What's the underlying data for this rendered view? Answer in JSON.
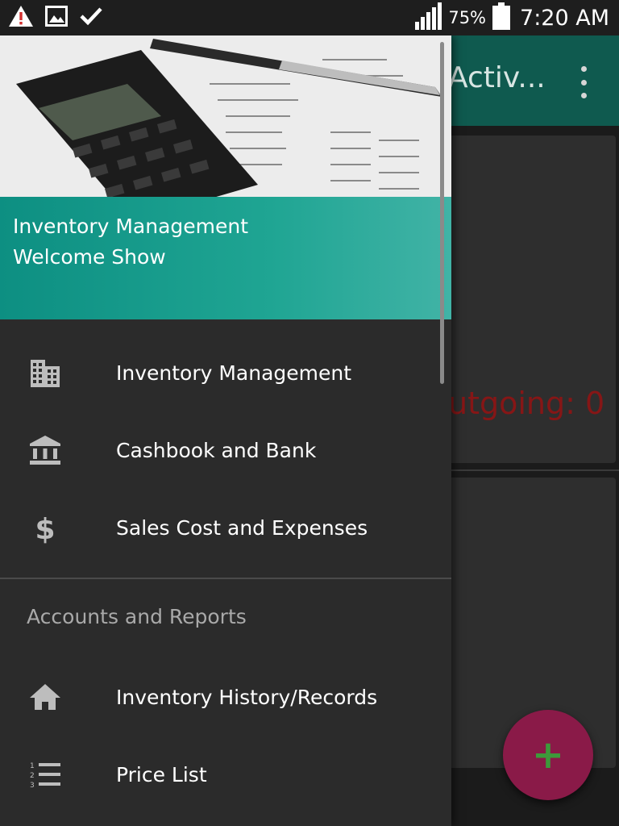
{
  "status_bar": {
    "left_icons": [
      "warning-icon",
      "image-icon",
      "check-icon"
    ],
    "battery_percent": "75%",
    "time": "7:20 AM"
  },
  "app_bar": {
    "title": "Activ..."
  },
  "background": {
    "outgoing_text": "utgoing: 0",
    "outgoing_color": "#861616"
  },
  "drawer": {
    "header": {
      "title": "Inventory Management",
      "subtitle": "Welcome Show",
      "band_color": "#1fa593"
    },
    "items": [
      {
        "label": "Inventory Management",
        "icon": "building-icon"
      },
      {
        "label": "Cashbook and Bank",
        "icon": "bank-icon"
      },
      {
        "label": "Sales Cost and Expenses",
        "icon": "dollar-icon"
      }
    ],
    "section_header": "Accounts and Reports",
    "section_items": [
      {
        "label": "Inventory History/Records",
        "icon": "home-icon"
      },
      {
        "label": "Price List",
        "icon": "numbered-list-icon"
      }
    ]
  },
  "fab": {
    "icon": "plus-icon",
    "label": "+",
    "color": "#8a1a48"
  }
}
